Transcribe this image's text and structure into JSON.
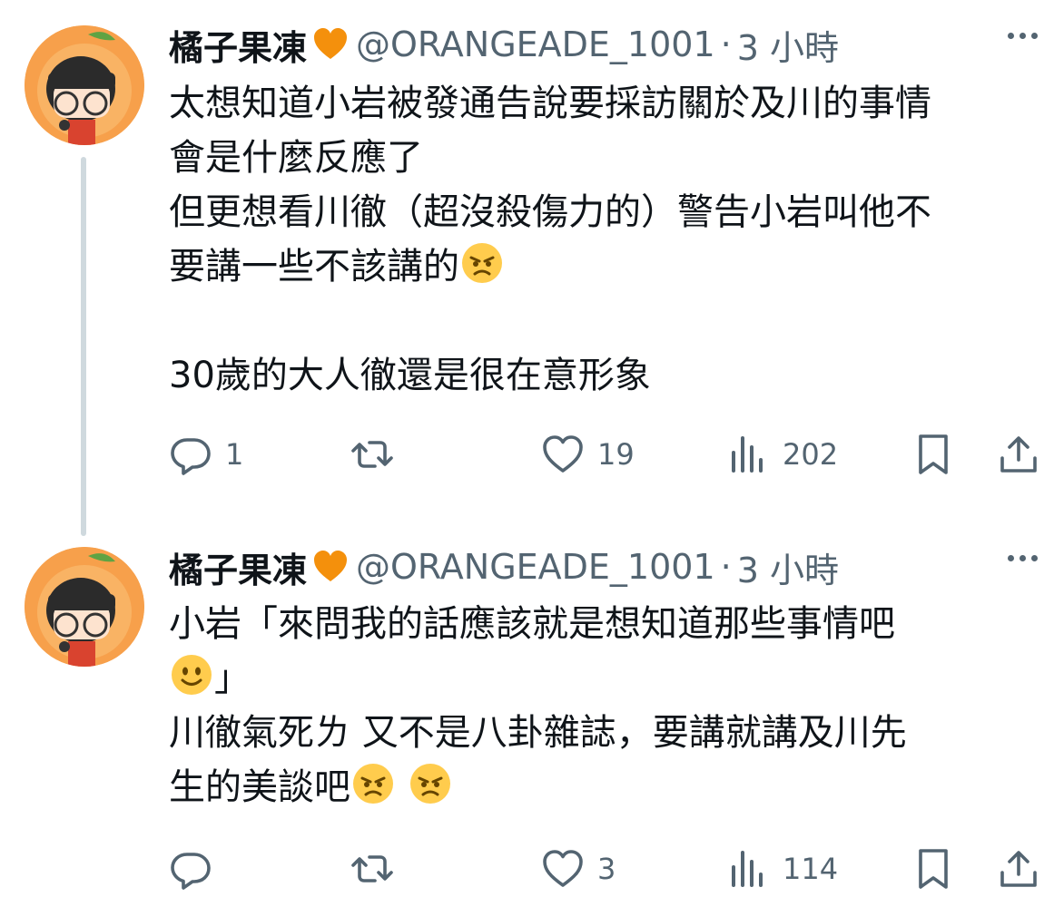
{
  "thread": [
    {
      "author_name": "橘子果凍",
      "author_handle": "@ORANGEADE_1001",
      "separator": "·",
      "time": "3 小時",
      "lines": [
        "太想知道小岩被發通告說要採訪關於及川的事情",
        "會是什麼反應了",
        "但更想看川徹（超沒殺傷力的）警告小岩叫他不",
        "要講一些不該講的",
        "",
        "30歲的大人徹還是很在意形象"
      ],
      "reply_count": "1",
      "retweet_count": "",
      "like_count": "19",
      "view_count": "202"
    },
    {
      "author_name": "橘子果凍",
      "author_handle": "@ORANGEADE_1001",
      "separator": "·",
      "time": "3 小時",
      "lines": [
        "小岩「來問我的話應該就是想知道那些事情吧",
        "」",
        "川徹氣死ㄌ 又不是八卦雜誌，要講就講及川先",
        "生的美談吧"
      ],
      "reply_count": "",
      "retweet_count": "",
      "like_count": "3",
      "view_count": "114"
    }
  ],
  "icons": {
    "name_badge": "orange-heart-icon",
    "more": "more-dots-icon",
    "reply": "reply-bubble-icon",
    "retweet": "retweet-icon",
    "like": "heart-outline-icon",
    "views": "views-bar-chart-icon",
    "bookmark": "bookmark-icon",
    "share": "share-upload-icon",
    "angry_emoji": "angry-face-emoji",
    "smile_emoji": "slightly-smiling-face-emoji"
  },
  "colors": {
    "text_primary": "#0f1419",
    "text_secondary": "#536471",
    "thread_line": "#cfd9de",
    "heart_badge": "#f4900c",
    "emoji_yellow": "#ffcc4d"
  }
}
